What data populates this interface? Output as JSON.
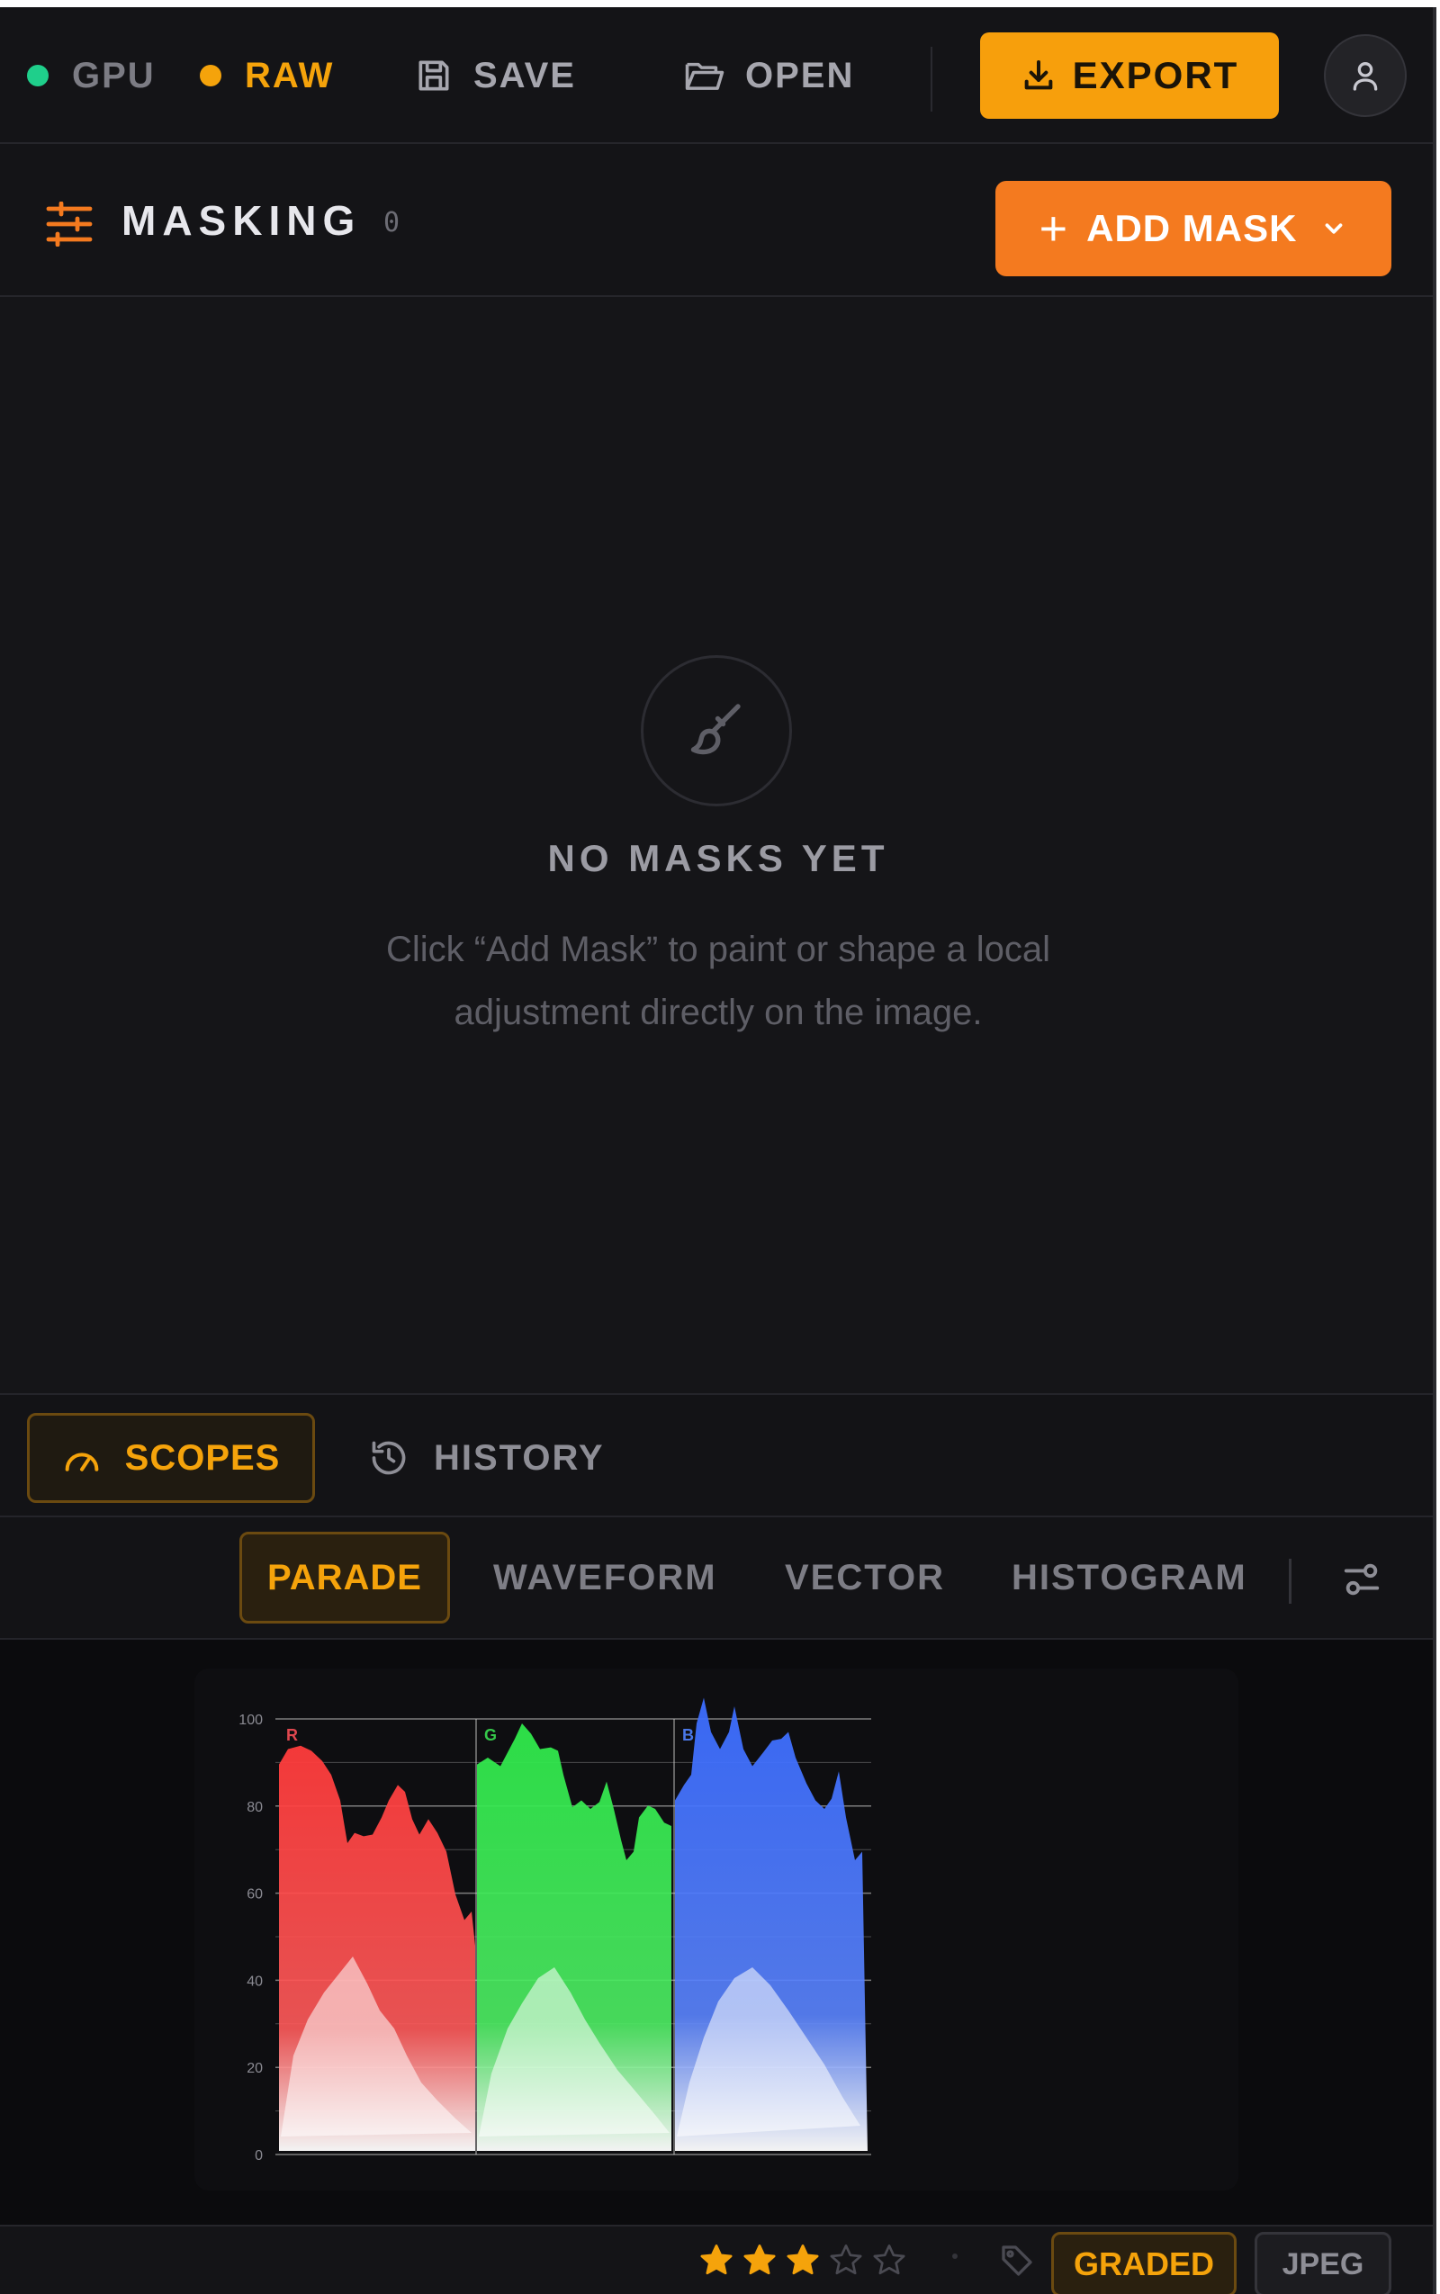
{
  "topbar": {
    "gpu_label": "GPU",
    "raw_label": "RAW",
    "save_label": "SAVE",
    "open_label": "OPEN",
    "export_label": "EXPORT",
    "gpu_status_color": "#1fcf8b",
    "raw_status_color": "#f5a30b",
    "accent_color": "#f79f0c"
  },
  "masking": {
    "title": "MASKING",
    "count": "0",
    "add_mask_label": "ADD MASK",
    "add_mask_color": "#f47a1f"
  },
  "empty_state": {
    "title": "NO MASKS YET",
    "description": "Click “Add Mask” to paint or shape a local adjustment directly on the image.",
    "icon": "brush-icon"
  },
  "panel_tabs": {
    "active": "scopes",
    "scopes_label": "SCOPES",
    "history_label": "HISTORY"
  },
  "scope_tabs": {
    "active": "parade",
    "labels": [
      "PARADE",
      "WAVEFORM",
      "VECTOR",
      "HISTOGRAM"
    ]
  },
  "parade": {
    "y_ticks": [
      "100",
      "80",
      "60",
      "40",
      "20",
      "0"
    ],
    "channels": [
      {
        "label": "R",
        "color": "#ff3b3b"
      },
      {
        "label": "G",
        "color": "#2ee84a"
      },
      {
        "label": "B",
        "color": "#3b6cff"
      }
    ]
  },
  "status": {
    "rating": 3,
    "rating_max": 5,
    "graded_label": "GRADED",
    "format_label": "JPEG"
  }
}
